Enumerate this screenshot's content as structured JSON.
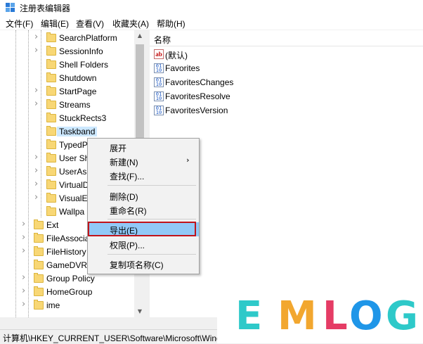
{
  "window": {
    "title": "注册表编辑器"
  },
  "menu": [
    "文件(F)",
    "编辑(E)",
    "查看(V)",
    "收藏夹(A)",
    "帮助(H)"
  ],
  "tree": {
    "items": [
      {
        "label": "SearchPlatform",
        "expandable": true
      },
      {
        "label": "SessionInfo",
        "expandable": true
      },
      {
        "label": "Shell Folders",
        "expandable": false
      },
      {
        "label": "Shutdown",
        "expandable": false
      },
      {
        "label": "StartPage",
        "expandable": true
      },
      {
        "label": "Streams",
        "expandable": true
      },
      {
        "label": "StuckRects3",
        "expandable": false
      },
      {
        "label": "Taskband",
        "expandable": false,
        "selected": true
      },
      {
        "label": "TypedP",
        "expandable": false
      },
      {
        "label": "User Sh",
        "expandable": true
      },
      {
        "label": "UserAs",
        "expandable": true
      },
      {
        "label": "VirtualD",
        "expandable": true
      },
      {
        "label": "VisualE",
        "expandable": true
      },
      {
        "label": "Wallpa",
        "expandable": false
      },
      {
        "label": "Ext",
        "expandable": true
      },
      {
        "label": "FileAssocia",
        "expandable": true
      },
      {
        "label": "FileHistory",
        "expandable": true
      },
      {
        "label": "GameDVR",
        "expandable": false
      },
      {
        "label": "Group Policy",
        "expandable": true
      },
      {
        "label": "HomeGroup",
        "expandable": true
      },
      {
        "label": "ime",
        "expandable": true
      }
    ]
  },
  "values_pane": {
    "header": "名称",
    "values": [
      {
        "icon": "ab",
        "name": "(默认)"
      },
      {
        "icon": "bin",
        "name": "Favorites"
      },
      {
        "icon": "bin",
        "name": "FavoritesChanges"
      },
      {
        "icon": "bin",
        "name": "FavoritesResolve"
      },
      {
        "icon": "bin",
        "name": "FavoritesVersion"
      }
    ]
  },
  "context_menu": {
    "expand": "展开",
    "new": "新建(N)",
    "find": "查找(F)...",
    "delete": "删除(D)",
    "rename": "重命名(R)",
    "export": "导出(E)",
    "permissions": "权限(P)...",
    "copy_key_name": "复制项名称(C)",
    "submenu_arrow": "›"
  },
  "status_bar": "计算机\\HKEY_CURRENT_USER\\Software\\Microsoft\\Wind",
  "watermark": {
    "letters": [
      {
        "char": "E",
        "color": "#2ec9c9"
      },
      {
        "char": "M",
        "color": "#f2a72f"
      },
      {
        "char": "L",
        "color": "#e53c65"
      },
      {
        "char": "O",
        "color": "#1f96e8"
      },
      {
        "char": "G",
        "color": "#2ec9c9"
      }
    ]
  },
  "icons": {
    "app": "registry-editor-icon",
    "folder": "folder-icon",
    "string_value": "string-value-icon",
    "binary_value": "binary-value-icon"
  }
}
